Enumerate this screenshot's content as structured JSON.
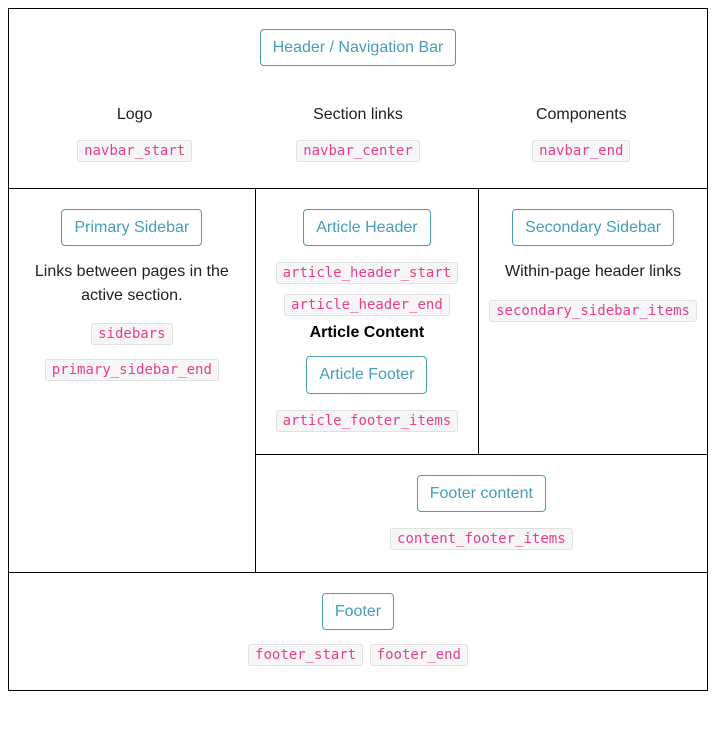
{
  "header": {
    "title": "Header / Navigation Bar",
    "cols": [
      {
        "label": "Logo",
        "code": "navbar_start"
      },
      {
        "label": "Section links",
        "code": "navbar_center"
      },
      {
        "label": "Components",
        "code": "navbar_end"
      }
    ]
  },
  "primary_sidebar": {
    "title": "Primary Sidebar",
    "desc": "Links between pages in the active section.",
    "codes": [
      "sidebars",
      "primary_sidebar_end"
    ]
  },
  "article": {
    "header_title": "Article Header",
    "header_codes": [
      "article_header_start",
      "article_header_end"
    ],
    "content_title": "Article Content",
    "footer_title": "Article Footer",
    "footer_code": "article_footer_items"
  },
  "secondary_sidebar": {
    "title": "Secondary Sidebar",
    "desc": "Within-page header links",
    "code": "secondary_sidebar_items"
  },
  "content_footer": {
    "title": "Footer content",
    "code": "content_footer_items"
  },
  "footer": {
    "title": "Footer",
    "codes": [
      "footer_start",
      "footer_end"
    ]
  }
}
